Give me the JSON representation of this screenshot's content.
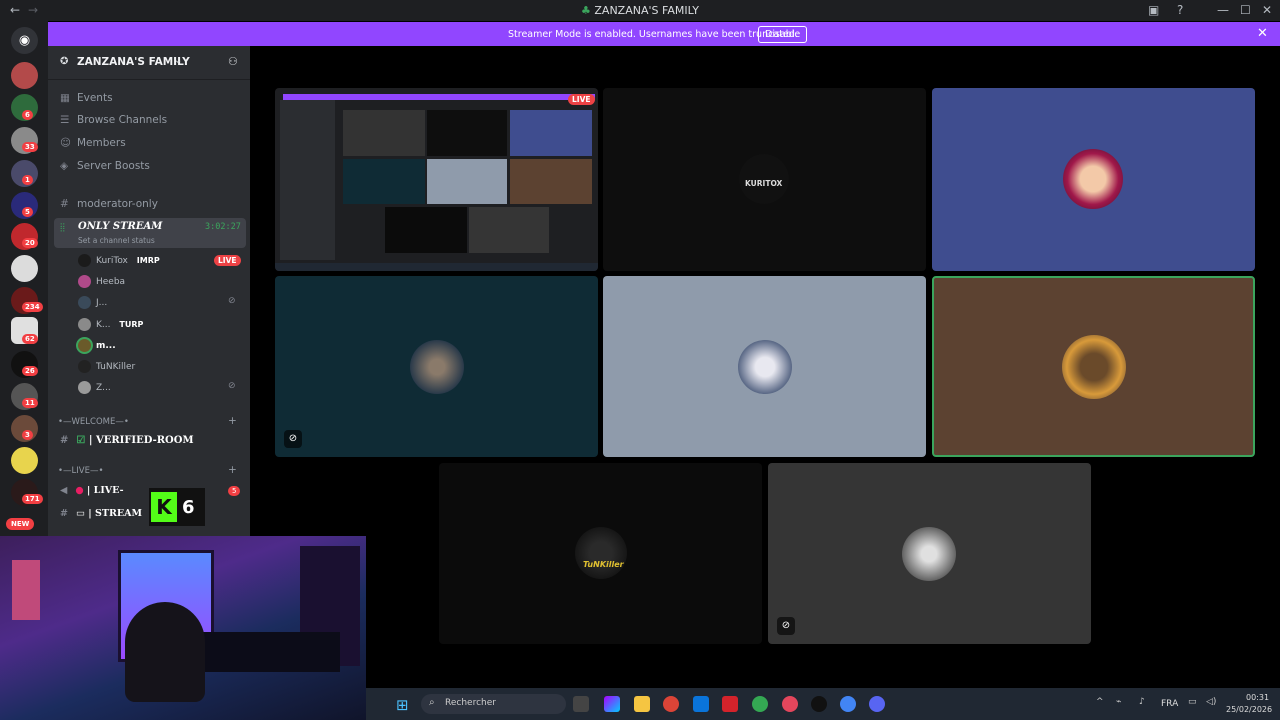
{
  "window": {
    "title": "ZANZANA'S FAMILY"
  },
  "banner": {
    "message": "Streamer Mode is enabled. Usernames have been truncated.",
    "disable_label": "Disable",
    "color": "#9146ff"
  },
  "server": {
    "name": "ZANZANA'S FAMILY"
  },
  "nav": [
    {
      "icon": "calendar-icon",
      "label": "Events"
    },
    {
      "icon": "browse-channels-icon",
      "label": "Browse Channels"
    },
    {
      "icon": "members-icon",
      "label": "Members"
    },
    {
      "icon": "boost-icon",
      "label": "Server Boosts"
    }
  ],
  "channels": {
    "moderator": "moderator-only",
    "voice_channel": "ONLY STREAM",
    "voice_timer": "3:02:27",
    "voice_status": "Set a channel status"
  },
  "voice_users": [
    {
      "name": "KuriTox",
      "tag": "IMRP",
      "live": "LIVE",
      "muted": false
    },
    {
      "name": "Heeba",
      "tag": "",
      "live": "",
      "muted": false
    },
    {
      "name": "J...",
      "tag": "",
      "live": "",
      "muted": true
    },
    {
      "name": "K...",
      "tag": "TURP",
      "live": "",
      "muted": false
    },
    {
      "name": "m...",
      "tag": "",
      "live": "",
      "muted": false
    },
    {
      "name": "TuNKiller",
      "tag": "",
      "live": "",
      "muted": false
    },
    {
      "name": "Z...",
      "tag": "",
      "live": "",
      "muted": true
    }
  ],
  "categories": [
    {
      "label": "•—WELCOME—•"
    },
    {
      "label": "•—LIVE—•"
    }
  ],
  "category_channels": [
    {
      "label": "| VERIFIED-ROOM",
      "badge": ""
    },
    {
      "label": "| LIVE-",
      "badge": "5"
    },
    {
      "label": "| STREAM",
      "badge": ""
    }
  ],
  "overlay_counter": {
    "letter": "K",
    "value": "6"
  },
  "rail_badges": [
    "6",
    "33",
    "1",
    "5",
    "20",
    "234",
    "62",
    "26",
    "11",
    "3",
    "171"
  ],
  "rail_new": "NEW",
  "stage": {
    "live_label": "LIVE",
    "kuritox_logo": "KURITOX",
    "tunkiller_logo": "TuNKiller"
  },
  "taskbar": {
    "search_placeholder": "Rechercher",
    "lang": "FRA",
    "time": "00:31",
    "date": "25/02/2026"
  },
  "colors": {
    "blurple_tile": "#3f4d8f",
    "teal_tile": "#0f2b35",
    "gray_tile": "#8f9bab",
    "brown_tile": "#5c4231",
    "dark_tile": "#0b0b0b",
    "gray2_tile": "#353535",
    "speaking": "#3ba55d"
  }
}
